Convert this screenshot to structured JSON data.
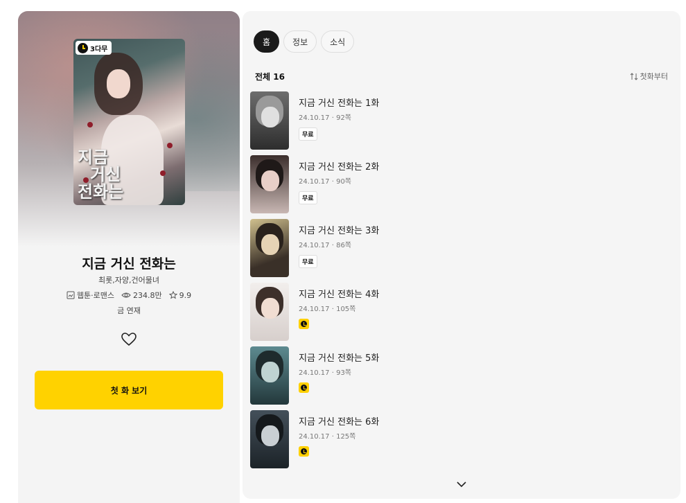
{
  "work": {
    "cover_badge": "3다무",
    "cover_title_line1": "지금",
    "cover_title_line2": "거신",
    "cover_title_line3": "전화는",
    "title": "지금 거신 전화는",
    "authors": "최롯,자양,건어물녀",
    "genre": "웹툰·로맨스",
    "views": "234.8만",
    "rating": "9.9",
    "schedule": "금 연재",
    "first_episode_button": "첫 화 보기"
  },
  "tabs": [
    {
      "label": "홈",
      "active": true
    },
    {
      "label": "정보",
      "active": false
    },
    {
      "label": "소식",
      "active": false
    }
  ],
  "list_header": {
    "count_label": "전체 16",
    "sort_label": "첫화부터"
  },
  "episodes": [
    {
      "title": "지금 거신 전화는 1화",
      "date": "24.10.17",
      "comments": "92쪽",
      "badge": "무료",
      "badge_type": "free"
    },
    {
      "title": "지금 거신 전화는 2화",
      "date": "24.10.17",
      "comments": "90쪽",
      "badge": "무료",
      "badge_type": "free"
    },
    {
      "title": "지금 거신 전화는 3화",
      "date": "24.10.17",
      "comments": "86쪽",
      "badge": "무료",
      "badge_type": "free"
    },
    {
      "title": "지금 거신 전화는 4화",
      "date": "24.10.17",
      "comments": "105쪽",
      "badge": "",
      "badge_type": "wait-free-icon"
    },
    {
      "title": "지금 거신 전화는 5화",
      "date": "24.10.17",
      "comments": "93쪽",
      "badge": "",
      "badge_type": "wait-free-icon"
    },
    {
      "title": "지금 거신 전화는 6화",
      "date": "24.10.17",
      "comments": "125쪽",
      "badge": "",
      "badge_type": "wait-free-icon"
    }
  ],
  "colors": {
    "accent": "#ffd200",
    "panel_bg": "#f5f5f5",
    "active_tab": "#1a1a1a"
  }
}
